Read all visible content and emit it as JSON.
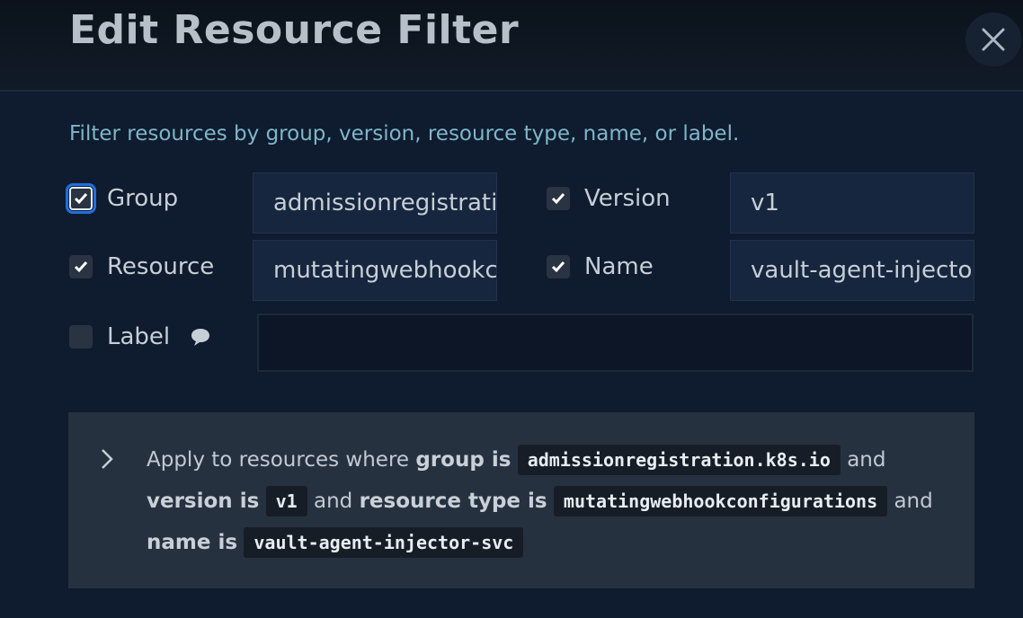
{
  "dialog": {
    "title": "Edit Resource Filter",
    "description": "Filter resources by group, version, resource type, name, or label."
  },
  "filters": {
    "group": {
      "label": "Group",
      "checked": true,
      "value": "admissionregistration.k8s.io"
    },
    "version": {
      "label": "Version",
      "checked": true,
      "value": "v1"
    },
    "resource": {
      "label": "Resource",
      "checked": true,
      "value": "mutatingwebhookconfigurations"
    },
    "name": {
      "label": "Name",
      "checked": true,
      "value": "vault-agent-injector-svc"
    },
    "label": {
      "label": "Label",
      "checked": false,
      "value": ""
    }
  },
  "summary": {
    "prefix": "Apply to resources where",
    "group_is": "group is",
    "group_value": "admissionregistration.k8s.io",
    "and1": "and",
    "version_is": "version is",
    "version_value": "v1",
    "and2": "and",
    "resource_is": "resource type is",
    "resource_value": "mutatingwebhookconfigurations",
    "and3": "and",
    "name_is": "name is",
    "name_value": "vault-agent-injector-svc"
  },
  "icons": {
    "close": "close-icon",
    "check": "check-icon",
    "comment": "comment-icon",
    "chevron": "chevron-right-icon"
  },
  "colors": {
    "background": "#0f1b2e",
    "accent": "#7eb6ca",
    "focus": "#1e6fe3"
  }
}
